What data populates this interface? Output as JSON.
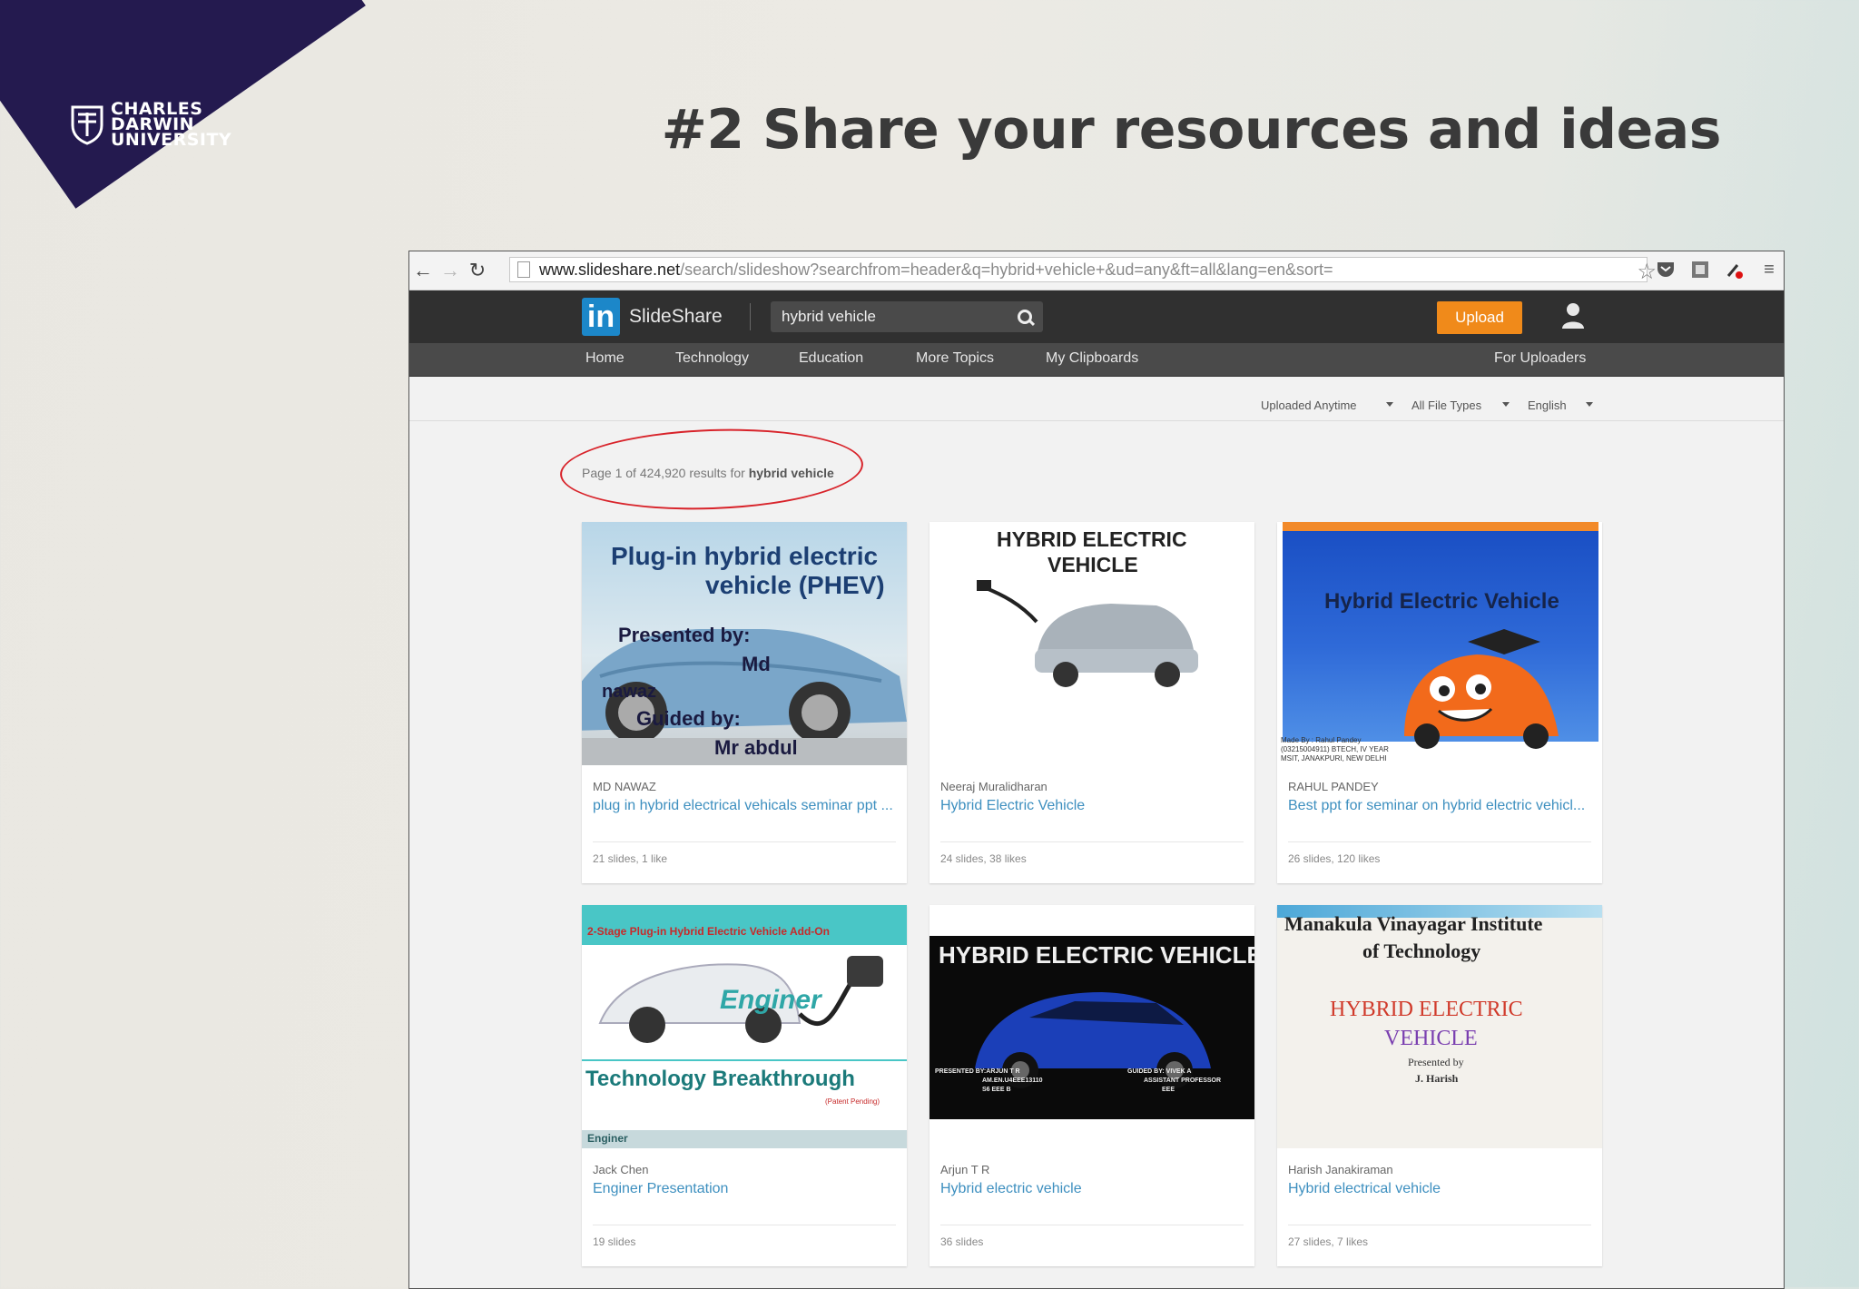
{
  "slide": {
    "title": "#2 Share your resources and ideas",
    "logo_lines": [
      "CHARLES",
      "DARWIN",
      "UNIVERSITY"
    ]
  },
  "browser": {
    "url_host": "www.slideshare.net",
    "url_path": "/search/slideshow?searchfrom=header&q=hybrid+vehicle+&ud=any&ft=all&lang=en&sort="
  },
  "header": {
    "logo_in": "in",
    "brand": "SlideShare",
    "search_value": "hybrid vehicle",
    "upload_label": "Upload"
  },
  "nav": {
    "items": [
      "Home",
      "Technology",
      "Education",
      "More Topics",
      "My Clipboards"
    ],
    "right_item": "For Uploaders"
  },
  "filters": [
    "Uploaded Anytime",
    "All File Types",
    "English"
  ],
  "results": {
    "prefix": "Page 1 of 424,920 results for",
    "query": "hybrid vehicle"
  },
  "cards": [
    {
      "author": "MD NAWAZ",
      "title": "plug in hybrid electrical vehicals seminar ppt ...",
      "stats": "21 slides, 1 like",
      "thumb_lines": [
        "Plug-in hybrid electric",
        "vehicle (PHEV)",
        "Presented by:",
        "Md",
        "nawaz",
        "Guided by:",
        "Mr abdul"
      ]
    },
    {
      "author": "Neeraj Muralidharan",
      "title": "Hybrid Electric Vehicle",
      "stats": "24 slides, 38 likes",
      "thumb_lines": [
        "HYBRID ELECTRIC",
        "VEHICLE"
      ]
    },
    {
      "author": "RAHUL PANDEY",
      "title": "Best ppt for seminar on hybrid electric vehicl...",
      "stats": "26 slides, 120 likes",
      "thumb_lines": [
        "Hybrid Electric Vehicle",
        "Made By : Rahul Pandey",
        "(03215004911) BTECH, IV YEAR",
        "MSIT, JANAKPURI, NEW DELHI"
      ]
    },
    {
      "author": "Jack Chen",
      "title": "Enginer Presentation",
      "stats": "19 slides",
      "thumb_lines": [
        "2-Stage Plug-in Hybrid Electric Vehicle Add-On",
        "Enginer",
        "Technology Breakthrough",
        "(Patent Pending)",
        "Enginer"
      ]
    },
    {
      "author": "Arjun T R",
      "title": "Hybrid electric vehicle",
      "stats": "36 slides",
      "thumb_lines": [
        "HYBRID ELECTRIC VEHICLE",
        "PRESENTED BY:ARJUN T R",
        "AM.EN.U4EEE13110",
        "S6 EEE B",
        "GUIDED BY: VIVEK A",
        "ASSISTANT PROFESSOR",
        "EEE"
      ]
    },
    {
      "author": "Harish Janakiraman",
      "title": "Hybrid electrical vehicle",
      "stats": "27 slides, 7 likes",
      "thumb_lines": [
        "Manakula Vinayagar Institute",
        "of Technology",
        "HYBRID ELECTRIC",
        "VEHICLE",
        "Presented by",
        "J. Harish"
      ]
    }
  ]
}
